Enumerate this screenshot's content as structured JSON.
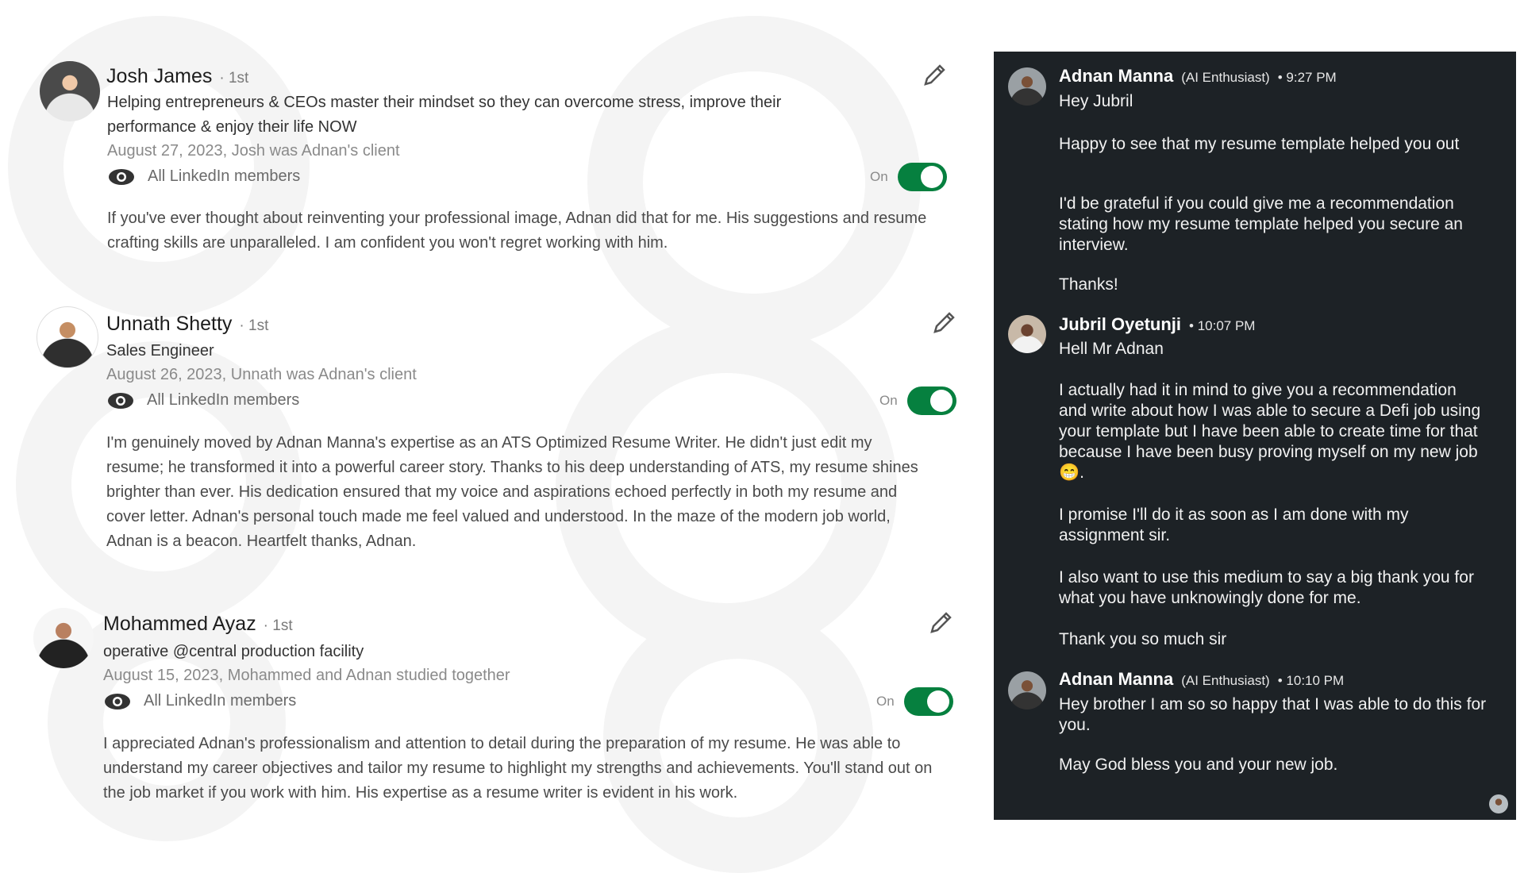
{
  "recommendations": [
    {
      "name": "Josh James",
      "degree": "· 1st",
      "headline": "Helping entrepreneurs & CEOs master their mindset so they can overcome stress, improve their",
      "headline2": "performance & enjoy their life NOW",
      "date_relation": "August 27, 2023, Josh was Adnan's client",
      "visibility": "All LinkedIn members",
      "toggle_label": "On",
      "toggle_on": true,
      "text": "If you've ever thought about reinventing your professional image, Adnan did that for me. His suggestions and resume crafting skills are unparalleled. I am confident you won't regret working with him."
    },
    {
      "name": "Unnath Shetty",
      "degree": "· 1st",
      "headline": "Sales Engineer",
      "date_relation": "August 26, 2023, Unnath was Adnan's client",
      "visibility": "All LinkedIn members",
      "toggle_label": "On",
      "toggle_on": true,
      "text": "I'm genuinely moved by Adnan Manna's expertise as an ATS Optimized Resume Writer. He didn't just edit my resume; he transformed it into a powerful career story. Thanks to his deep understanding of ATS, my resume shines brighter than ever. His dedication ensured that my voice and aspirations echoed perfectly in both my resume and cover letter. Adnan's personal touch made me feel valued and understood. In the maze of the modern job world, Adnan is a beacon. Heartfelt thanks, Adnan."
    },
    {
      "name": "Mohammed Ayaz",
      "degree": "· 1st",
      "headline": "operative @central production facility",
      "date_relation": "August 15, 2023, Mohammed and Adnan studied together",
      "visibility": "All LinkedIn members",
      "toggle_label": "On",
      "toggle_on": true,
      "text": "I appreciated Adnan's professionalism and attention to detail during the preparation of my resume. He was able to understand my career objectives and tailor my resume to highlight my strengths and achievements. You'll stand out on the job market if you work with him. His expertise as a resume writer is evident in his work."
    }
  ],
  "chat": {
    "messages": [
      {
        "name": "Adnan Manna",
        "tag": "(AI Enthusiast)",
        "time": "• 9:27 PM",
        "paragraphs": [
          "Hey Jubril",
          "Happy to see that my resume template helped you out",
          "I'd be grateful if you could give me a recommendation stating how my resume template helped you secure an interview.",
          "Thanks!"
        ]
      },
      {
        "name": "Jubril Oyetunji",
        "tag": "",
        "time": "• 10:07 PM",
        "paragraphs": [
          "Hell Mr Adnan",
          "I actually had it in mind to give you a recommendation and write about how I was able to secure a Defi job using your template but I have been able to create time for that because I have been busy proving myself on my new job 😁.",
          "I promise I'll do it as soon as I am done with my assignment sir.",
          "I also want to use this medium to say a big thank you for what you have unknowingly done for me.",
          "Thank you so much sir"
        ]
      },
      {
        "name": "Adnan Manna",
        "tag": "(AI Enthusiast)",
        "time": "• 10:10 PM",
        "paragraphs": [
          "Hey brother I am so so happy that I was able to do this for you.",
          "May God bless you and your new job."
        ]
      }
    ]
  },
  "colors": {
    "toggle_green": "#06803f",
    "chat_background": "#1d2226"
  },
  "icons": [
    "eye-icon",
    "pencil-icon",
    "avatar"
  ]
}
